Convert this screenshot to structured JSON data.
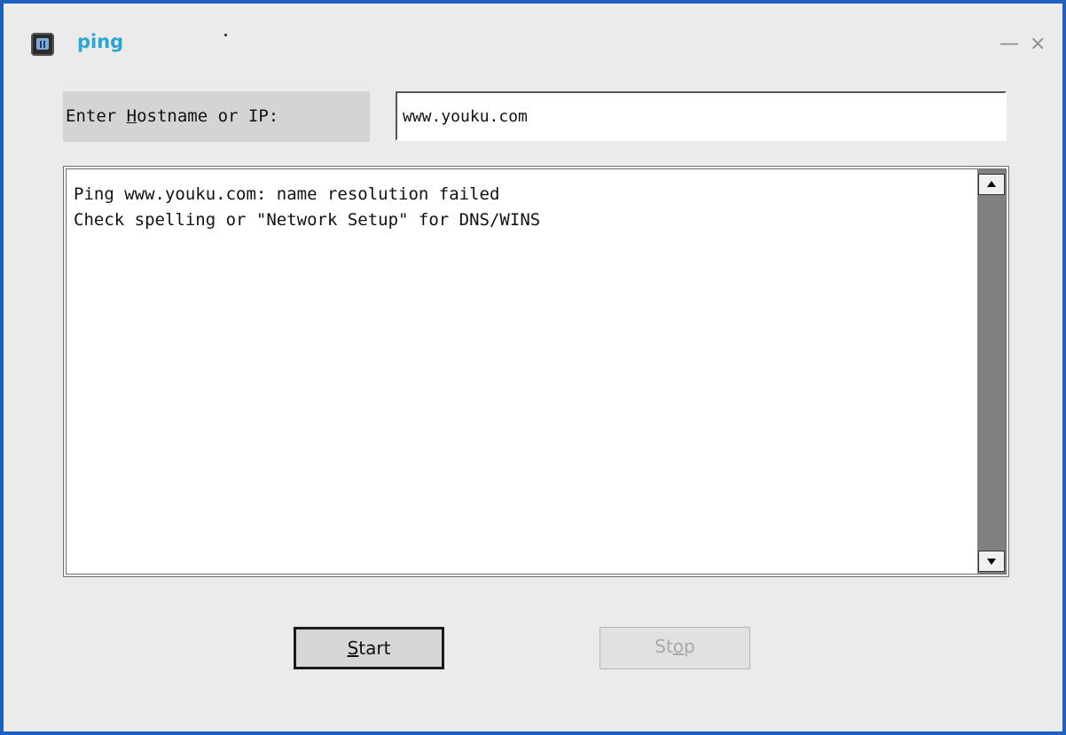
{
  "window": {
    "title": "ping",
    "minimize_glyph": "—",
    "close_glyph": "×"
  },
  "form": {
    "host_label_prefix": "Enter ",
    "host_label_mnemonic": "H",
    "host_label_suffix": "ostname or IP:",
    "host_value": "www.youku.com"
  },
  "output": {
    "lines": "Ping www.youku.com: name resolution failed\nCheck spelling or \"Network Setup\" for DNS/WINS"
  },
  "buttons": {
    "start_mnemonic": "S",
    "start_rest": "tart",
    "stop_pre": "St",
    "stop_mnemonic": "o",
    "stop_post": "p"
  },
  "icons": {
    "app": "ping-app-icon",
    "scroll_up": "scroll-up-arrow-icon",
    "scroll_down": "scroll-down-arrow-icon"
  },
  "colors": {
    "title": "#2aa6d6",
    "window_bg": "#ebebeb",
    "frame": "#1f5fc0"
  }
}
